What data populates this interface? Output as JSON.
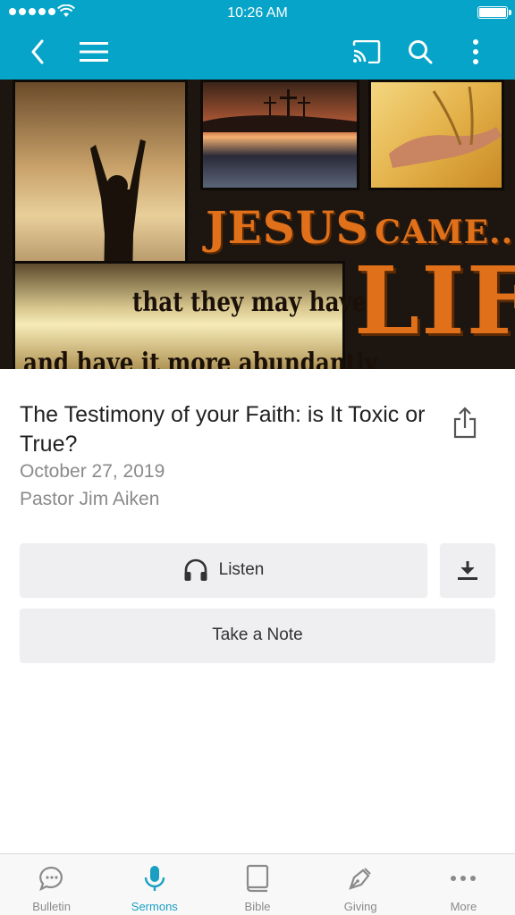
{
  "status_bar": {
    "time": "10:26 AM"
  },
  "hero": {
    "line_top": "JESUS",
    "line_top_small": "CAME...",
    "line_mid": "that they may have",
    "line_big": "LIFE",
    "line_bottom": "and have it more abundantly"
  },
  "sermon": {
    "title": "The Testimony of your Faith: is It Toxic or True?",
    "date": "October 27, 2019",
    "pastor": "Pastor Jim Aiken"
  },
  "actions": {
    "listen_label": "Listen",
    "note_label": "Take a Note"
  },
  "tabs": [
    {
      "label": "Bulletin",
      "icon": "chat-bubble-icon"
    },
    {
      "label": "Sermons",
      "icon": "microphone-icon",
      "active": true
    },
    {
      "label": "Bible",
      "icon": "book-icon"
    },
    {
      "label": "Giving",
      "icon": "pen-icon"
    },
    {
      "label": "More",
      "icon": "more-dots-icon"
    }
  ],
  "colors": {
    "accent": "#06a4c8",
    "tab_active": "#1a9fc3",
    "button_bg": "#efeff1"
  }
}
